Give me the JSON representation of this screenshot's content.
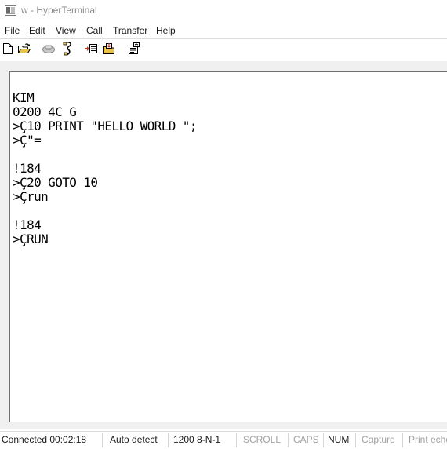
{
  "window": {
    "title": "w - HyperTerminal"
  },
  "menu": {
    "items": [
      "File",
      "Edit",
      "View",
      "Call",
      "Transfer",
      "Help"
    ]
  },
  "toolbar": {
    "icons": [
      "new-icon",
      "open-icon",
      "phone-icon",
      "disconnect-icon",
      "send-icon",
      "receive-icon",
      "properties-icon"
    ]
  },
  "terminal": {
    "lines": [
      "KIM",
      "0200 4C G",
      ">Ç10 PRINT \"HELLO WORLD \";",
      ">Ç\"=",
      "",
      "!184",
      ">Ç20 GOTO 10",
      ">Çrun",
      "",
      "!184",
      ">ÇRUN"
    ]
  },
  "statusbar": {
    "connected": "Connected 00:02:18",
    "detect": "Auto detect",
    "settings": "1200 8-N-1",
    "scroll": "SCROLL",
    "caps": "CAPS",
    "num": "NUM",
    "capture": "Capture",
    "print_echo": "Print echo"
  },
  "colors": {
    "title_inactive": "#8a8a8a",
    "status_active": "#1a1a1a",
    "status_inactive": "#a0a0a0"
  }
}
